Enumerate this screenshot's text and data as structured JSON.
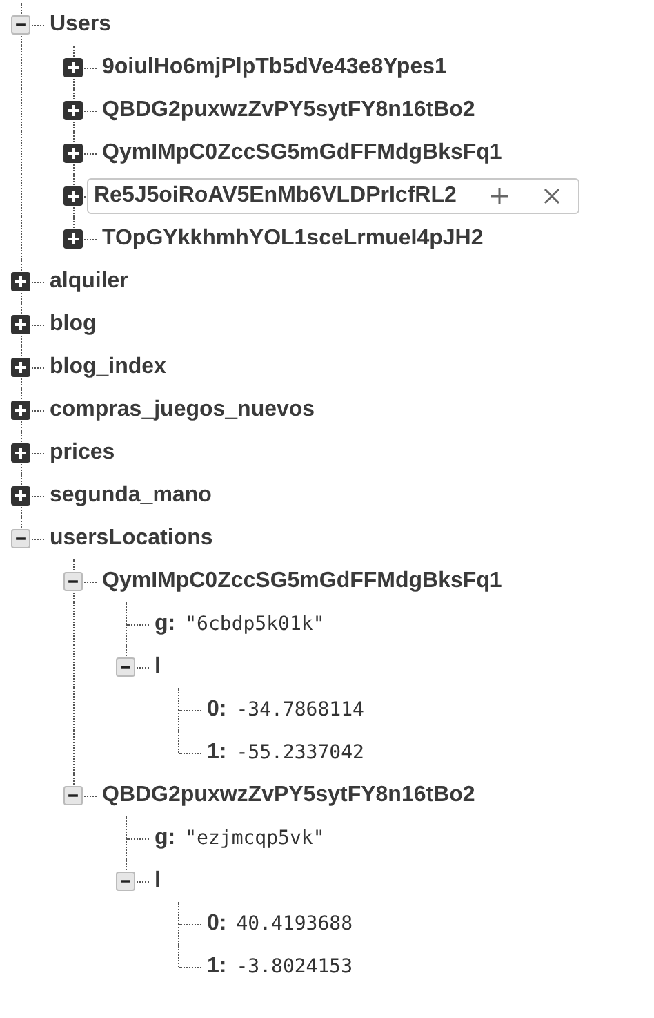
{
  "tree": [
    {
      "kind": "node",
      "key": "Users",
      "expanded": true,
      "children": [
        {
          "kind": "node",
          "key": "9oiulHo6mjPlpTb5dVe43e8Ypes1",
          "expanded": false,
          "hovered": false
        },
        {
          "kind": "node",
          "key": "QBDG2puxwzZvPY5sytFY8n16tBo2",
          "expanded": false,
          "hovered": false
        },
        {
          "kind": "node",
          "key": "QymIMpC0ZccSG5mGdFFMdgBksFq1",
          "expanded": false,
          "hovered": false
        },
        {
          "kind": "node",
          "key": "Re5J5oiRoAV5EnMb6VLDPrIcfRL2",
          "expanded": false,
          "hovered": true
        },
        {
          "kind": "node",
          "key": "TOpGYkkhmhYOL1sceLrmueI4pJH2",
          "expanded": false,
          "hovered": false
        }
      ]
    },
    {
      "kind": "node",
      "key": "alquiler",
      "expanded": false
    },
    {
      "kind": "node",
      "key": "blog",
      "expanded": false
    },
    {
      "kind": "node",
      "key": "blog_index",
      "expanded": false
    },
    {
      "kind": "node",
      "key": "compras_juegos_nuevos",
      "expanded": false
    },
    {
      "kind": "node",
      "key": "prices",
      "expanded": false
    },
    {
      "kind": "node",
      "key": "segunda_mano",
      "expanded": false
    },
    {
      "kind": "node",
      "key": "usersLocations",
      "expanded": true,
      "children": [
        {
          "kind": "node",
          "key": "QymIMpC0ZccSG5mGdFFMdgBksFq1",
          "expanded": true,
          "children": [
            {
              "kind": "leaf",
              "key": "g:",
              "value": "\"6cbdp5k01k\""
            },
            {
              "kind": "node",
              "key": "l",
              "expanded": true,
              "children": [
                {
                  "kind": "leaf",
                  "key": "0:",
                  "value": "-34.7868114"
                },
                {
                  "kind": "leaf",
                  "key": "1:",
                  "value": "-55.2337042"
                }
              ]
            }
          ]
        },
        {
          "kind": "node",
          "key": "QBDG2puxwzZvPY5sytFY8n16tBo2",
          "expanded": true,
          "children": [
            {
              "kind": "leaf",
              "key": "g:",
              "value": "\"ezjmcqp5vk\""
            },
            {
              "kind": "node",
              "key": "l",
              "expanded": true,
              "children": [
                {
                  "kind": "leaf",
                  "key": "0:",
                  "value": "40.4193688"
                },
                {
                  "kind": "leaf",
                  "key": "1:",
                  "value": "-3.8024153"
                }
              ]
            }
          ]
        }
      ]
    }
  ]
}
